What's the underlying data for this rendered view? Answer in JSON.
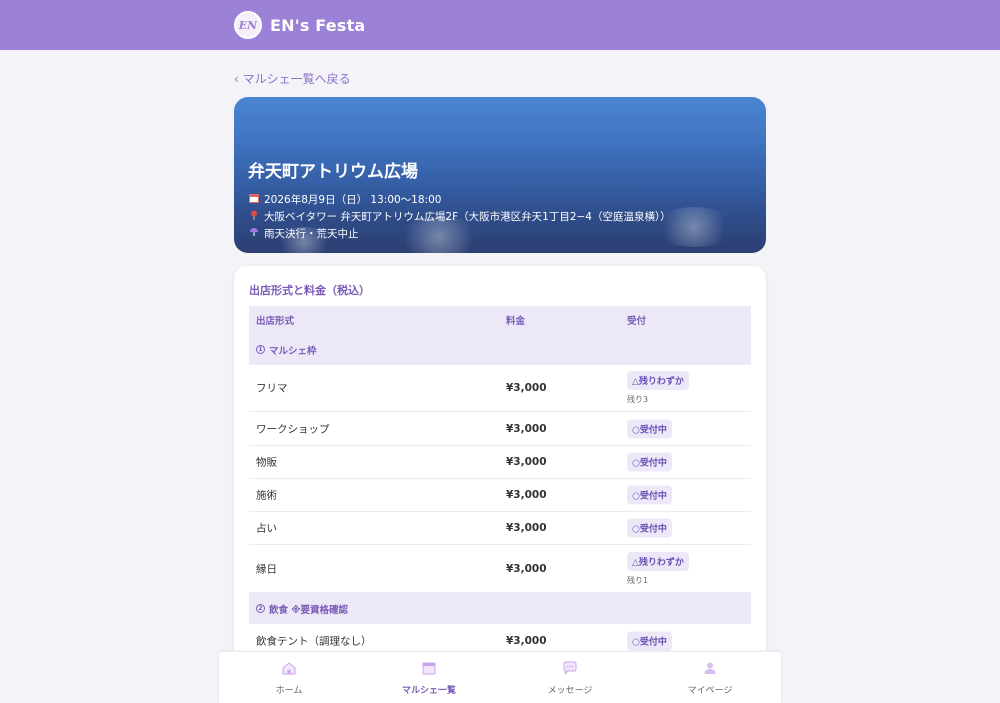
{
  "header": {
    "logo_text": "EN",
    "brand_name": "EN's Festa"
  },
  "back_link": "‹ マルシェ一覧へ戻る",
  "event": {
    "title": "弁天町アトリウム広場",
    "date": "2026年8月9日（日） 13:00〜18:00",
    "place": "大阪ベイタワー 弁天町アトリウム広場2F（大阪市港区弁天1丁目2−4（空庭温泉横））",
    "weather": "雨天決行・荒天中止",
    "icons": {
      "date": "calendar-icon",
      "place": "pin-icon",
      "weather": "rain-icon"
    }
  },
  "pricing": {
    "title": "出店形式と料金（税込）",
    "columns": [
      "出店形式",
      "料金",
      "受付"
    ],
    "groups": [
      {
        "number": "1",
        "label": "マルシェ枠",
        "rows": [
          {
            "type": "フリマ",
            "price": "¥3,000",
            "status": "△残りわずか",
            "note": "残り3"
          },
          {
            "type": "ワークショップ",
            "price": "¥3,000",
            "status": "○受付中",
            "note": ""
          },
          {
            "type": "物販",
            "price": "¥3,000",
            "status": "○受付中",
            "note": ""
          },
          {
            "type": "施術",
            "price": "¥3,000",
            "status": "○受付中",
            "note": ""
          },
          {
            "type": "占い",
            "price": "¥3,000",
            "status": "○受付中",
            "note": ""
          },
          {
            "type": "縁日",
            "price": "¥3,000",
            "status": "△残りわずか",
            "note": "残り1"
          }
        ]
      },
      {
        "number": "2",
        "label": "飲食 ※要資格確認",
        "rows": [
          {
            "type": "飲食テント（調理なし）",
            "price": "¥3,000",
            "status": "○受付中",
            "note": ""
          }
        ]
      }
    ]
  },
  "bottom_nav": {
    "items": [
      {
        "label": "ホーム",
        "icon": "home-icon"
      },
      {
        "label": "マルシェ一覧",
        "icon": "calendar-icon"
      },
      {
        "label": "メッセージ",
        "icon": "chat-icon"
      },
      {
        "label": "マイページ",
        "icon": "user-icon"
      }
    ],
    "active": "マルシェ一覧"
  },
  "colors": {
    "header_bg": "#9b82d6",
    "accent": "#7a5cb8",
    "badge_bg": "#ece8f8"
  }
}
